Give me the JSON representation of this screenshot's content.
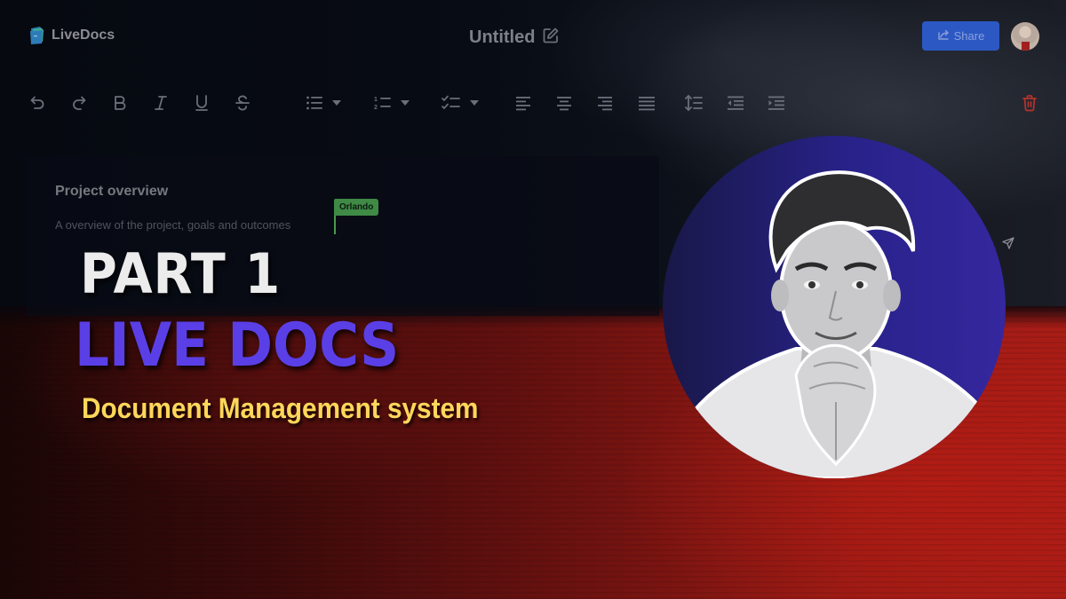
{
  "app": {
    "name": "LiveDocs",
    "logo_icon": "folder-docs-icon"
  },
  "header": {
    "title": "Untitled",
    "edit_icon": "edit-icon",
    "share_label": "Share",
    "share_icon": "share-icon",
    "share_color": "#2c58c4",
    "avatar": "user-avatar"
  },
  "toolbar": {
    "items": [
      {
        "name": "undo",
        "icon": "undo-icon"
      },
      {
        "name": "redo",
        "icon": "redo-icon"
      },
      {
        "name": "bold",
        "icon": "bold-icon",
        "glyph": "B"
      },
      {
        "name": "italic",
        "icon": "italic-icon",
        "glyph": "I"
      },
      {
        "name": "underline",
        "icon": "underline-icon",
        "glyph": "U"
      },
      {
        "name": "strikethrough",
        "icon": "strikethrough-icon",
        "glyph": "S"
      },
      {
        "name": "bullet-list",
        "icon": "bullet-list-icon",
        "dropdown": true
      },
      {
        "name": "numbered-list",
        "icon": "numbered-list-icon",
        "dropdown": true
      },
      {
        "name": "check-list",
        "icon": "check-list-icon",
        "dropdown": true
      },
      {
        "name": "align-left",
        "icon": "align-left-icon"
      },
      {
        "name": "align-center",
        "icon": "align-center-icon"
      },
      {
        "name": "align-right",
        "icon": "align-right-icon"
      },
      {
        "name": "align-justify",
        "icon": "align-justify-icon"
      },
      {
        "name": "line-height",
        "icon": "line-height-icon"
      },
      {
        "name": "outdent",
        "icon": "outdent-icon"
      },
      {
        "name": "indent",
        "icon": "indent-icon"
      },
      {
        "name": "delete",
        "icon": "trash-icon",
        "color": "#c0392b"
      }
    ]
  },
  "document": {
    "heading": "Project overview",
    "body": "A overview of the project, goals and outcomes",
    "collaborator_cursor": {
      "name": "Orlando",
      "color": "#3f8a45"
    }
  },
  "overlay": {
    "part": "PART 1",
    "title": "LIVE DOCS",
    "subtitle": "Document Management system",
    "title_color": "#5a3fe6",
    "subtitle_color": "#ffd75a"
  },
  "presenter": {
    "image": "presenter-portrait"
  }
}
